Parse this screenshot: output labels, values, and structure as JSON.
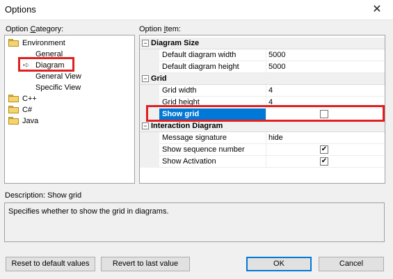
{
  "window": {
    "title": "Options",
    "close_glyph": "✕"
  },
  "labels": {
    "category_prefix": "Option ",
    "category_key": "C",
    "category_suffix": "ategory:",
    "item_prefix": "Option ",
    "item_key": "I",
    "item_suffix": "tem:"
  },
  "tree": {
    "items": [
      {
        "label": "Environment",
        "icon": "folder-icon"
      },
      {
        "label": "General"
      },
      {
        "label": "Diagram",
        "selected": true,
        "icon": "arrow-right-icon"
      },
      {
        "label": "General View"
      },
      {
        "label": "Specific View"
      },
      {
        "label": "C++",
        "icon": "folder-icon"
      },
      {
        "label": "C#",
        "icon": "folder-icon"
      },
      {
        "label": "Java",
        "icon": "folder-icon"
      }
    ]
  },
  "grid": {
    "categories": [
      {
        "label": "Diagram Size",
        "properties": [
          {
            "name": "Default diagram width",
            "value": "5000"
          },
          {
            "name": "Default diagram height",
            "value": "5000"
          }
        ]
      },
      {
        "label": "Grid",
        "properties": [
          {
            "name": "Grid width",
            "value": "4"
          },
          {
            "name": "Grid height",
            "value": "4"
          },
          {
            "name": "Show grid",
            "value": "",
            "checked": false,
            "selected": true
          }
        ]
      },
      {
        "label": "Interaction Diagram",
        "properties": [
          {
            "name": "Message signature",
            "value": "hide"
          },
          {
            "name": "Show sequence number",
            "value": "",
            "checked": true
          },
          {
            "name": "Show Activation",
            "value": "",
            "checked": true
          }
        ]
      }
    ],
    "collapse_glyph": "−"
  },
  "description": {
    "label_prefix": "Description: ",
    "label_name": "Show grid",
    "text": "Specifies whether to show the grid in diagrams."
  },
  "buttons": {
    "reset": "Reset to default values",
    "revert": "Revert to last value",
    "ok": "OK",
    "cancel": "Cancel"
  },
  "colors": {
    "highlight": "#e02020",
    "selection": "#0078d7"
  },
  "check_glyph": "✔"
}
